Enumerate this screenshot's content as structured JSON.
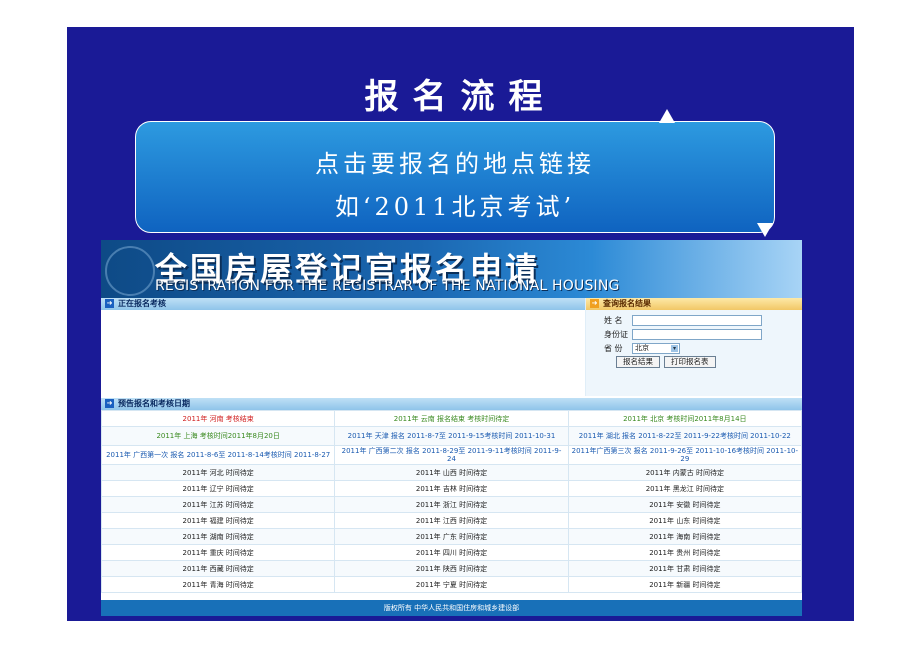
{
  "slide": {
    "title": "报名流程",
    "callout_line1": "点击要报名的地点链接",
    "callout_line2": "如‘2011北京考试’"
  },
  "site": {
    "banner_title": "全国房屋登记官报名申请",
    "banner_subtitle": "REGISTRATION FOR THE REGISTRAR OF THE NATIONAL HOUSING",
    "current_exams_heading": "正在报名考核",
    "query_heading": "查询报名结果",
    "query_form": {
      "name_label": "姓 名",
      "id_label": "身份证",
      "province_label": "省 份",
      "province_value": "北京",
      "result_button": "报名结果",
      "print_button": "打印报名表"
    },
    "schedule_heading": "预告报名和考核日期",
    "schedule_rows": [
      [
        {
          "text": "2011年 河南 考核结束",
          "color": "red"
        },
        {
          "text": "2011年 云南 报名结束 考核时间待定",
          "color": "green"
        },
        {
          "text": "2011年 北京 考核时间2011年8月14日",
          "color": "green"
        }
      ],
      [
        {
          "text": "2011年 上海 考核时间2011年8月20日",
          "color": "green"
        },
        {
          "text": "2011年 天津 报名 2011-8-7至 2011-9-15考核时间 2011-10-31",
          "color": "blue"
        },
        {
          "text": "2011年 湖北 报名 2011-8-22至 2011-9-22考核时间 2011-10-22",
          "color": "blue"
        }
      ],
      [
        {
          "text": "2011年 广西第一次 报名 2011-8-6至 2011-8-14考核时间 2011-8-27",
          "color": "blue"
        },
        {
          "text": "2011年 广西第二次 报名 2011-8-29至 2011-9-11考核时间 2011-9-24",
          "color": "blue"
        },
        {
          "text": "2011年广西第三次 报名 2011-9-26至 2011-10-16考核时间 2011-10-29",
          "color": "blue"
        }
      ],
      [
        {
          "text": "2011年 河北 时间待定",
          "color": "dark"
        },
        {
          "text": "2011年 山西 时间待定",
          "color": "dark"
        },
        {
          "text": "2011年 内蒙古 时间待定",
          "color": "dark"
        }
      ],
      [
        {
          "text": "2011年 辽宁 时间待定",
          "color": "dark"
        },
        {
          "text": "2011年 吉林 时间待定",
          "color": "dark"
        },
        {
          "text": "2011年 黑龙江 时间待定",
          "color": "dark"
        }
      ],
      [
        {
          "text": "2011年 江苏 时间待定",
          "color": "dark"
        },
        {
          "text": "2011年 浙江 时间待定",
          "color": "dark"
        },
        {
          "text": "2011年 安徽 时间待定",
          "color": "dark"
        }
      ],
      [
        {
          "text": "2011年 福建 时间待定",
          "color": "dark"
        },
        {
          "text": "2011年 江西 时间待定",
          "color": "dark"
        },
        {
          "text": "2011年 山东 时间待定",
          "color": "dark"
        }
      ],
      [
        {
          "text": "2011年 湖南 时间待定",
          "color": "dark"
        },
        {
          "text": "2011年 广东 时间待定",
          "color": "dark"
        },
        {
          "text": "2011年 海南 时间待定",
          "color": "dark"
        }
      ],
      [
        {
          "text": "2011年 重庆 时间待定",
          "color": "dark"
        },
        {
          "text": "2011年 四川 时间待定",
          "color": "dark"
        },
        {
          "text": "2011年 贵州 时间待定",
          "color": "dark"
        }
      ],
      [
        {
          "text": "2011年 西藏 时间待定",
          "color": "dark"
        },
        {
          "text": "2011年 陕西 时间待定",
          "color": "dark"
        },
        {
          "text": "2011年 甘肃 时间待定",
          "color": "dark"
        }
      ],
      [
        {
          "text": "2011年 青海 时间待定",
          "color": "dark"
        },
        {
          "text": "2011年 宁夏 时间待定",
          "color": "dark"
        },
        {
          "text": "2011年 新疆 时间待定",
          "color": "dark"
        }
      ]
    ],
    "footer": "版权所有 中华人民共和国住房和城乡建设部"
  },
  "colors": {
    "slide_background": "#1a1a96",
    "callout_fill": "#1f7fd0",
    "banner_blue": "#1a66b0",
    "footer_blue": "#1870b8"
  }
}
